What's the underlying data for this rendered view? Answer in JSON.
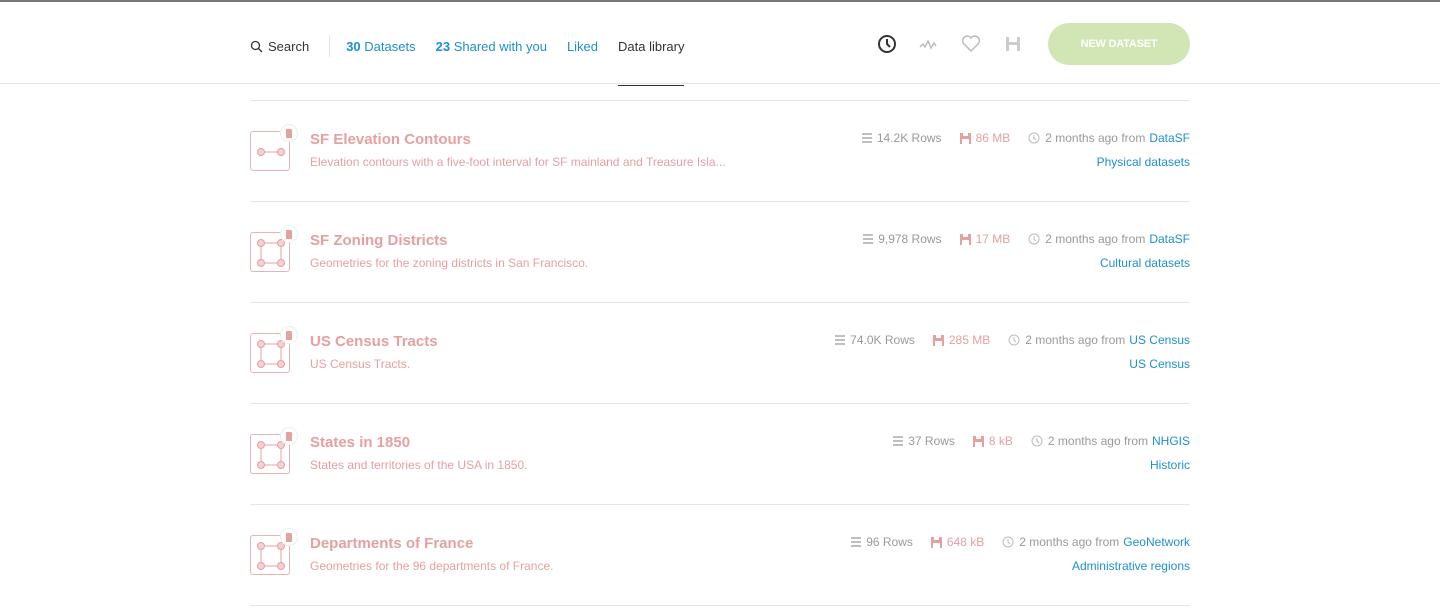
{
  "nav": {
    "search": "Search",
    "datasets_count": "30",
    "datasets_label": "Datasets",
    "shared_count": "23",
    "shared_label": "Shared with you",
    "liked": "Liked",
    "library": "Data library"
  },
  "toolbar": {
    "new_dataset": "NEW DATASET"
  },
  "datasets": [
    {
      "title": "SF Elevation Contours",
      "description": "Elevation contours with a five-foot interval for SF mainland and Treasure Isla...",
      "rows": "14.2K Rows",
      "size": "86 MB",
      "updated": "2 months ago",
      "from": "from",
      "source": "DataSF",
      "tag": "Physical datasets",
      "geom": "line"
    },
    {
      "title": "SF Zoning Districts",
      "description": "Geometries for the zoning districts in San Francisco.",
      "rows": "9,978 Rows",
      "size": "17 MB",
      "updated": "2 months ago",
      "from": "from",
      "source": "DataSF",
      "tag": "Cultural datasets",
      "geom": "polygon"
    },
    {
      "title": "US Census Tracts",
      "description": "US Census Tracts.",
      "rows": "74.0K Rows",
      "size": "285 MB",
      "updated": "2 months ago",
      "from": "from",
      "source": "US Census",
      "tag": "US Census",
      "geom": "polygon"
    },
    {
      "title": "States in 1850",
      "description": "States and territories of the USA in 1850.",
      "rows": "37 Rows",
      "size": "8 kB",
      "updated": "2 months ago",
      "from": "from",
      "source": "NHGIS",
      "tag": "Historic",
      "geom": "polygon"
    },
    {
      "title": "Departments of France",
      "description": "Geometries for the 96 departments of France.",
      "rows": "96 Rows",
      "size": "648 kB",
      "updated": "2 months ago",
      "from": "from",
      "source": "GeoNetwork",
      "tag": "Administrative regions",
      "geom": "polygon"
    }
  ]
}
